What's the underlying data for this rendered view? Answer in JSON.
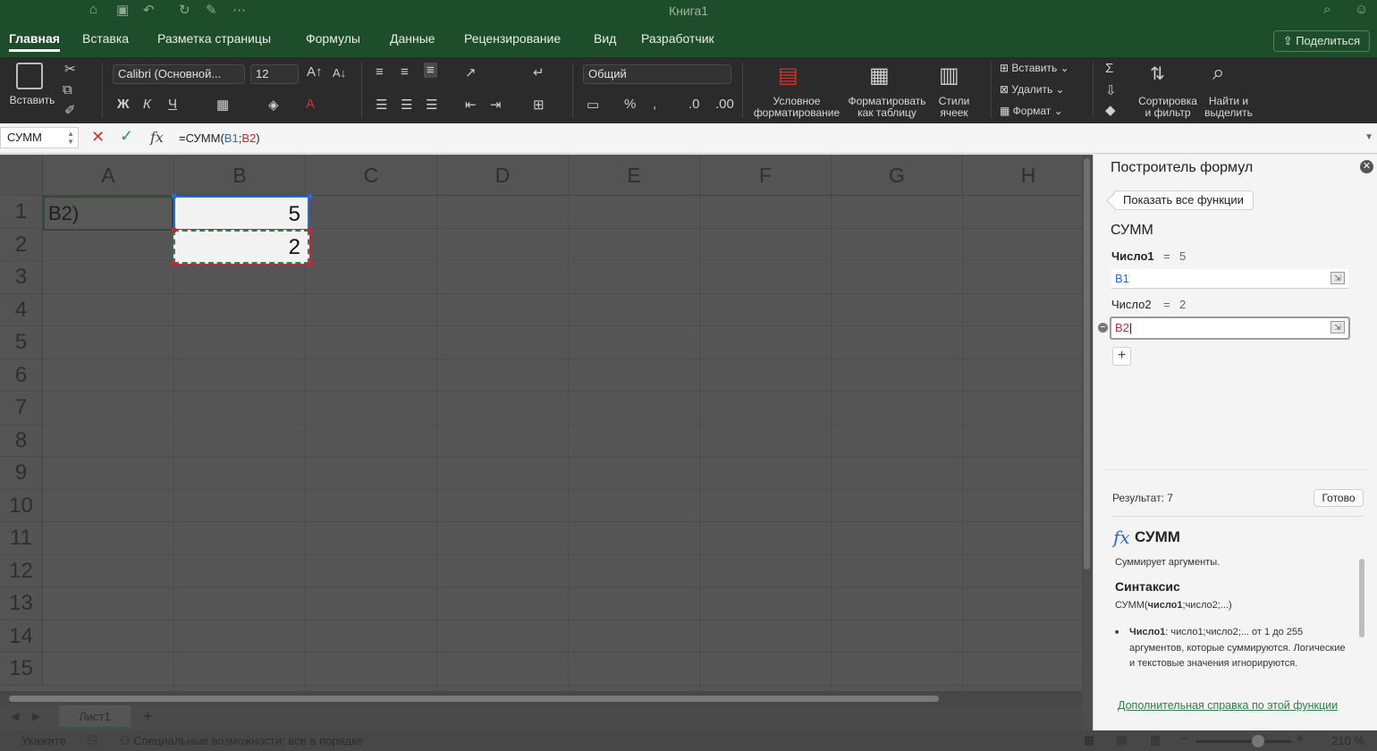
{
  "window": {
    "title": "Книга1"
  },
  "tabs": [
    "Главная",
    "Вставка",
    "Разметка страницы",
    "Формулы",
    "Данные",
    "Рецензирование",
    "Вид",
    "Разработчик"
  ],
  "share_label": "Поделиться",
  "ribbon": {
    "paste_label": "Вставить",
    "font_name": "Calibri (Основной...",
    "font_size": "12",
    "number_format": "Общий",
    "bold": "Ж",
    "italic": "К",
    "underline": "Ч",
    "cond_format_1": "Условное",
    "cond_format_2": "форматирование",
    "format_table_1": "Форматировать",
    "format_table_2": "как таблицу",
    "cell_styles_1": "Стили",
    "cell_styles_2": "ячеек",
    "insert_cells": "Вставить",
    "delete_cells": "Удалить",
    "format_cells": "Формат",
    "sort_filter_1": "Сортировка",
    "sort_filter_2": "и фильтр",
    "find_select_1": "Найти и",
    "find_select_2": "выделить"
  },
  "formula_bar": {
    "name_box": "СУММ",
    "prefix": "=СУММ(",
    "ref1": "B1",
    "sep": ";",
    "ref2": "B2",
    "suffix": ")",
    "fx": "fx"
  },
  "grid": {
    "columns": [
      "A",
      "B",
      "C",
      "D",
      "E",
      "F",
      "G",
      "H"
    ],
    "rows": [
      "1",
      "2",
      "3",
      "4",
      "5",
      "6",
      "7",
      "8",
      "9",
      "10",
      "11",
      "12",
      "13",
      "14",
      "15"
    ],
    "a1": "B2)",
    "b1": "5",
    "b2": "2",
    "accent_colors": {
      "ref1": "#2a6ad0",
      "ref2": "#c0293b",
      "selection": "#3d7a4a"
    }
  },
  "sheets": {
    "tab": "Лист1",
    "add": "+"
  },
  "status": {
    "mode": "Укажите",
    "accessibility": "Специальные возможности: все в порядке",
    "zoom": "210 %"
  },
  "pane": {
    "title": "Построитель формул",
    "show_all": "Показать все функции",
    "function": "СУММ",
    "arg1_label": "Число1",
    "arg1_eq": "=",
    "arg1_val": "5",
    "arg1_input": "B1",
    "arg2_label": "Число2",
    "arg2_eq": "=",
    "arg2_val": "2",
    "arg2_input": "B2",
    "result": "Результат: 7",
    "done": "Готово",
    "help_fx": "fx",
    "help_name": "СУММ",
    "help_desc": "Суммирует аргументы.",
    "syntax_heading": "Синтаксис",
    "syntax_fn": "СУММ(",
    "syntax_bold": "число1",
    "syntax_rest": ";число2;...)",
    "arg_desc_bold": "Число1",
    "arg_desc_text": ": число1;число2;... от 1 до 255 аргументов, которые суммируются. Логические и текстовые значения игнорируются.",
    "help_link": "Дополнительная справка по этой функции"
  }
}
